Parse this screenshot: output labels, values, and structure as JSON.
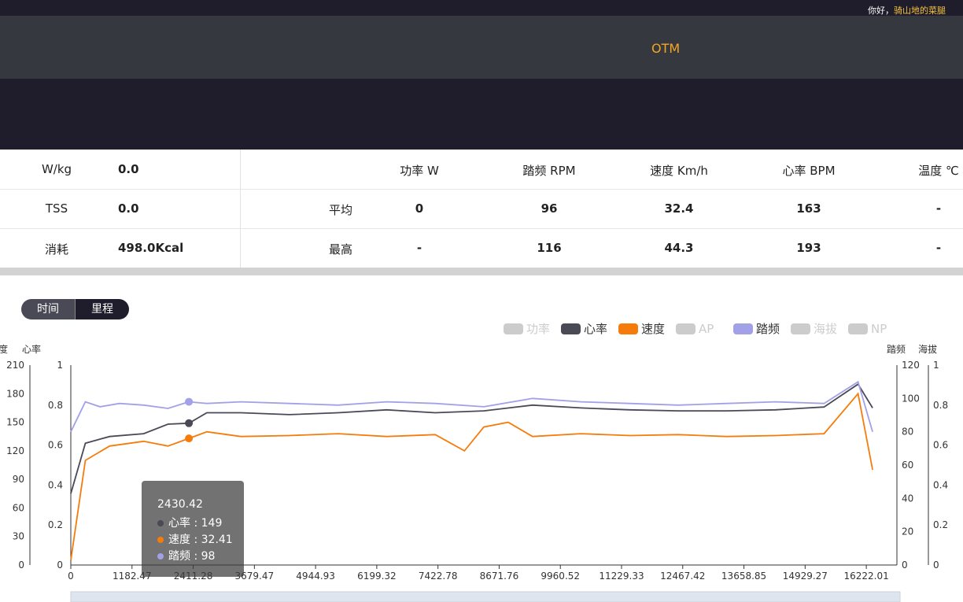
{
  "header": {
    "greeting": "你好，",
    "username": "骑山地的菜腿",
    "nav_title": "OTM"
  },
  "summary": {
    "left": [
      {
        "label": "W/kg",
        "value": "0.0"
      },
      {
        "label": "TSS",
        "value": "0.0"
      },
      {
        "label": "消耗",
        "value": "498.0Kcal"
      }
    ],
    "columns": [
      "功率 W",
      "踏频 RPM",
      "速度 Km/h",
      "心率 BPM",
      "温度 ℃"
    ],
    "rows": [
      {
        "label": "平均",
        "values": [
          "0",
          "96",
          "32.4",
          "163",
          "-"
        ]
      },
      {
        "label": "最高",
        "values": [
          "-",
          "116",
          "44.3",
          "193",
          "-"
        ]
      }
    ]
  },
  "toggle": {
    "time": "时间",
    "distance": "里程"
  },
  "legend": [
    {
      "name": "功率",
      "color": "#cccccc",
      "active": false
    },
    {
      "name": "心率",
      "color": "#4a4956",
      "active": true
    },
    {
      "name": "速度",
      "color": "#f57c0b",
      "active": true
    },
    {
      "name": "AP",
      "color": "#cccccc",
      "active": false
    },
    {
      "name": "踏频",
      "color": "#a2a1e8",
      "active": true
    },
    {
      "name": "海拔",
      "color": "#cccccc",
      "active": false
    },
    {
      "name": "NP",
      "color": "#cccccc",
      "active": false
    }
  ],
  "axes": {
    "left_speed": {
      "name": "度",
      "ticks": [
        "210",
        "180",
        "150",
        "120",
        "90",
        "60",
        "30",
        "0"
      ]
    },
    "left_hr": {
      "name": "心率",
      "ticks": [
        "1",
        "0.8",
        "0.6",
        "0.4",
        "0.2",
        "0"
      ]
    },
    "right_cadence": {
      "name": "踏频",
      "ticks": [
        "120",
        "100",
        "80",
        "60",
        "40",
        "20",
        "0"
      ]
    },
    "right_alt": {
      "name": "海拔",
      "ticks": [
        "1",
        "0.8",
        "0.6",
        "0.4",
        "0.2",
        "0"
      ]
    },
    "x_ticks": [
      "0",
      "1182.47",
      "2411.28",
      "3679.47",
      "4944.93",
      "6199.32",
      "7422.78",
      "8671.76",
      "9960.52",
      "11229.33",
      "12467.42",
      "13658.85",
      "14929.27",
      "16222.01"
    ]
  },
  "tooltip": {
    "title": "2430.42",
    "rows": [
      {
        "name": "心率",
        "value": "149",
        "color": "#4a4956"
      },
      {
        "name": "速度",
        "value": "32.41",
        "color": "#f57c0b"
      },
      {
        "name": "踏频",
        "value": "98",
        "color": "#a2a1e8"
      }
    ]
  },
  "chart_data": {
    "type": "line",
    "x_label": "",
    "x_range": [
      0,
      17000
    ],
    "series": [
      {
        "name": "心率",
        "axis": "left-hr",
        "ylim": [
          0,
          210
        ],
        "x": [
          0,
          300,
          800,
          1500,
          2000,
          2430,
          2800,
          3500,
          4500,
          5500,
          6500,
          7500,
          8500,
          9500,
          10500,
          11500,
          12500,
          13500,
          14500,
          15500,
          16200,
          16500
        ],
        "values": [
          75,
          128,
          135,
          138,
          148,
          149,
          160,
          160,
          158,
          160,
          163,
          160,
          162,
          168,
          165,
          163,
          162,
          162,
          163,
          166,
          190,
          165
        ]
      },
      {
        "name": "速度",
        "axis": "left-speed",
        "ylim": [
          0,
          210
        ],
        "x": [
          0,
          300,
          800,
          1500,
          2000,
          2430,
          2800,
          3500,
          4500,
          5500,
          6500,
          7500,
          8100,
          8500,
          9000,
          9500,
          10500,
          11500,
          12500,
          13500,
          14500,
          15500,
          16200,
          16500
        ],
        "values": [
          5,
          110,
          125,
          130,
          125,
          133,
          140,
          135,
          136,
          138,
          135,
          137,
          120,
          145,
          150,
          135,
          138,
          136,
          137,
          135,
          136,
          138,
          180,
          100
        ]
      },
      {
        "name": "踏频",
        "axis": "right-cadence",
        "ylim": [
          0,
          120
        ],
        "x": [
          0,
          300,
          600,
          1000,
          1500,
          2000,
          2430,
          2800,
          3500,
          4500,
          5500,
          6500,
          7500,
          8500,
          9500,
          10500,
          11500,
          12500,
          13500,
          14500,
          15500,
          16200,
          16500
        ],
        "values": [
          80,
          98,
          95,
          97,
          96,
          94,
          98,
          97,
          98,
          97,
          96,
          98,
          97,
          95,
          100,
          98,
          97,
          96,
          97,
          98,
          97,
          110,
          80
        ]
      }
    ]
  }
}
